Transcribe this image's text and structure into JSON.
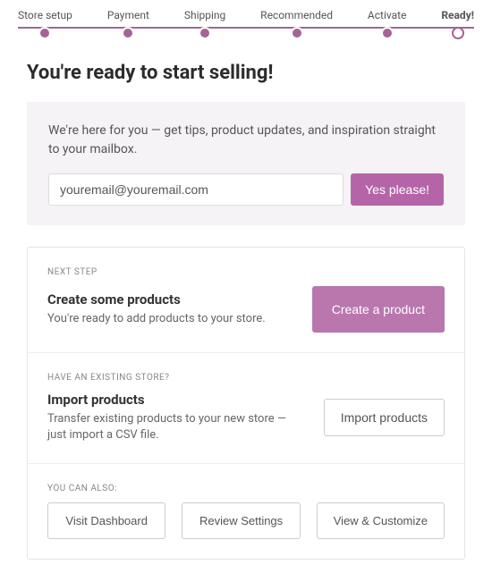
{
  "stepper": {
    "items": [
      {
        "label": "Store setup"
      },
      {
        "label": "Payment"
      },
      {
        "label": "Shipping"
      },
      {
        "label": "Recommended"
      },
      {
        "label": "Activate"
      },
      {
        "label": "Ready!"
      }
    ]
  },
  "heading": "You're ready to start selling!",
  "mail": {
    "text": "We're here for you — get tips, product updates, and inspiration straight to your mailbox.",
    "value": "youremail@youremail.com",
    "button": "Yes please!"
  },
  "next_step": {
    "eyebrow": "NEXT STEP",
    "title": "Create some products",
    "desc": "You're ready to add products to your store.",
    "button": "Create a product"
  },
  "import": {
    "eyebrow": "HAVE AN EXISTING STORE?",
    "title": "Import products",
    "desc": "Transfer existing products to your new store — just import a CSV file.",
    "button": "Import products"
  },
  "also": {
    "eyebrow": "YOU CAN ALSO:",
    "buttons": [
      "Visit Dashboard",
      "Review Settings",
      "View & Customize"
    ]
  }
}
